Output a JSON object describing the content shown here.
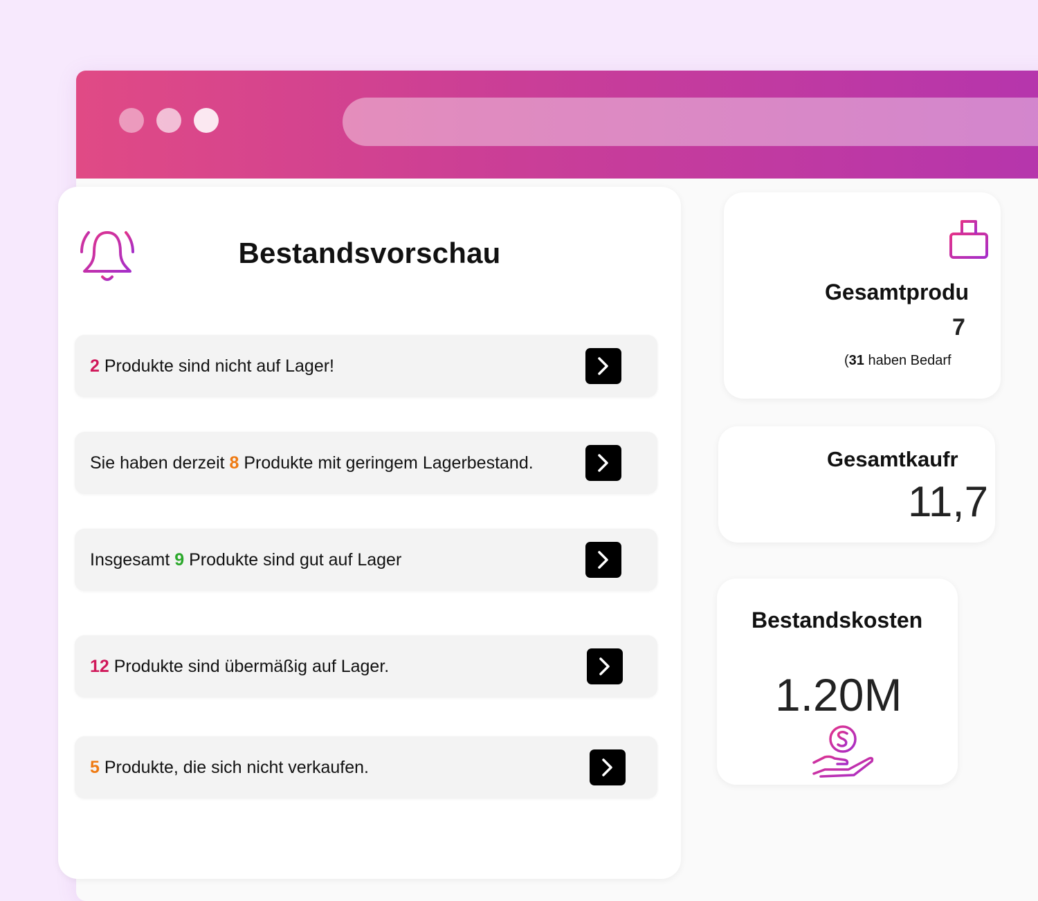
{
  "colors": {
    "background": "#f7e9fd",
    "accent_pink": "#d0185a",
    "accent_orange": "#ef7a12",
    "accent_green": "#2aa82a",
    "titlebar_gradient": [
      "#e04a85",
      "#b535ad"
    ]
  },
  "overview": {
    "title": "Bestandsvorschau",
    "icon": "bell-icon",
    "rows": [
      {
        "prefix": "",
        "number": "2",
        "suffix": " Produkte sind nicht auf Lager!",
        "number_color": "pink"
      },
      {
        "prefix": "Sie haben derzeit ",
        "number": "8",
        "suffix": " Produkte mit geringem Lagerbestand.",
        "number_color": "orange"
      },
      {
        "prefix": "Insgesamt ",
        "number": "9",
        "suffix": " Produkte sind gut auf Lager",
        "number_color": "green"
      },
      {
        "prefix": "",
        "number": "12",
        "suffix": " Produkte sind übermäßig auf Lager.",
        "number_color": "pink"
      },
      {
        "prefix": "",
        "number": "5",
        "suffix": " Produkte, die sich nicht verkaufen.",
        "number_color": "orange"
      }
    ]
  },
  "cards": {
    "total": {
      "title": "Gesamtprodu",
      "value": "7",
      "note_open": "(",
      "note_number": "31",
      "note_rest": " haben Bedarf",
      "icon": "box-icon"
    },
    "purchase": {
      "title": "Gesamtkaufr",
      "value": "11,7"
    },
    "cost": {
      "title": "Bestandskosten",
      "value": "1.20M",
      "icon": "money-hand-icon"
    }
  }
}
